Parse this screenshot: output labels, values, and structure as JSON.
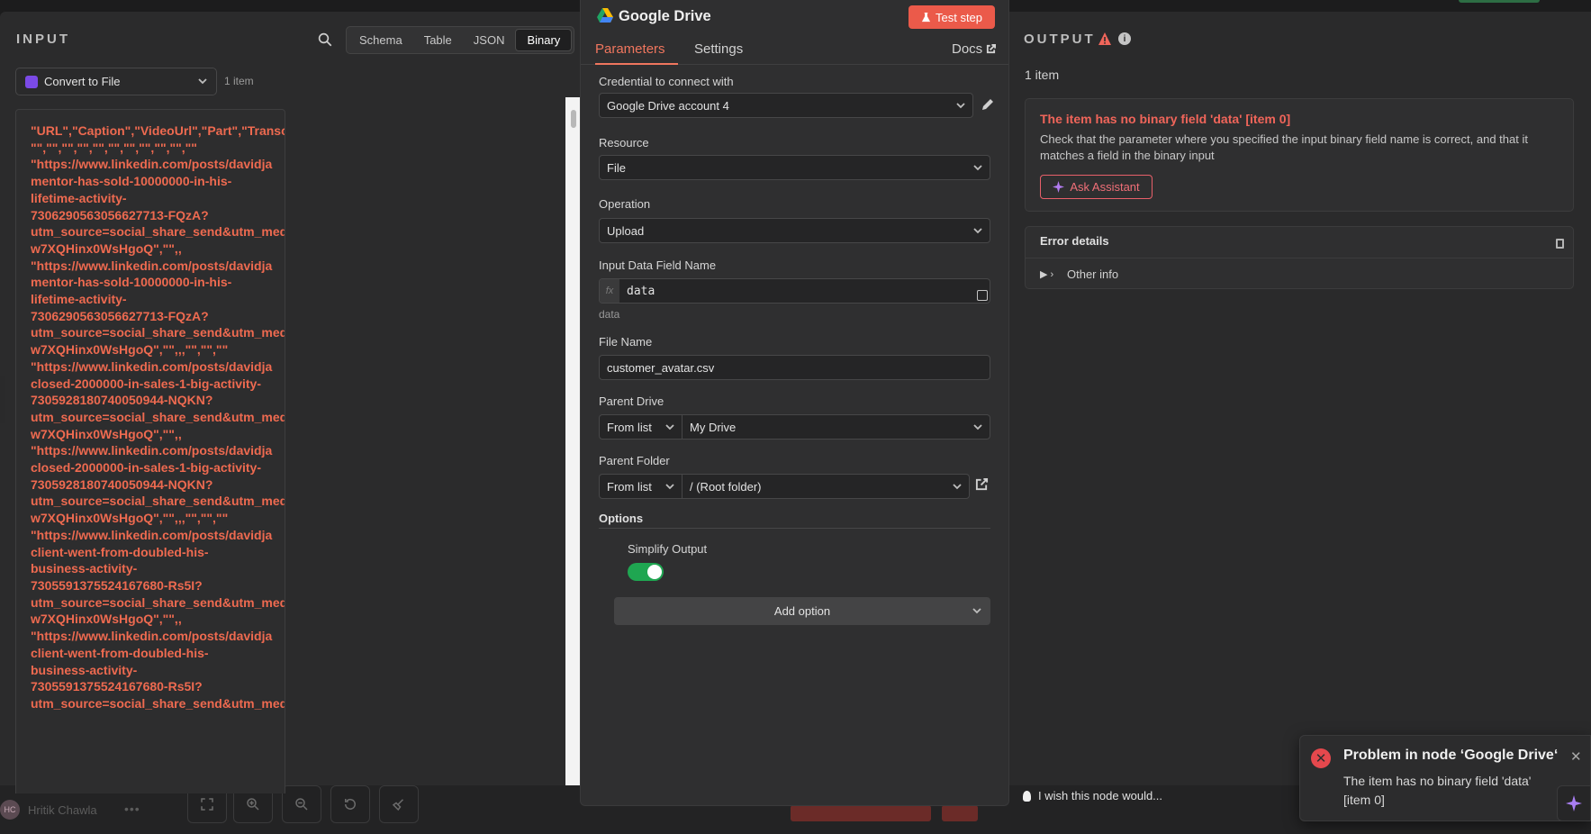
{
  "input_panel": {
    "title": "INPUT",
    "view_tabs": [
      "Schema",
      "Table",
      "JSON",
      "Binary"
    ],
    "active_view_tab": "Binary",
    "node_select_value": "Convert to File",
    "item_count": "1 item",
    "csv_lines": [
      "\"URL\",\"Caption\",\"VideoUrl\",\"Part\",\"Transc",
      "\"\",\"\",\"\",\"\",\"\",\"\",\"\",\"\",\"\",\"\",\"\"",
      "\"https://www.linkedin.com/posts/davidja",
      "mentor-has-sold-10000000-in-his-",
      "lifetime-activity-",
      "7306290563056627713-FQzA?",
      "utm_source=social_share_send&utm_med",
      "w7XQHinx0WsHgoQ\",\"\",,",
      "\"https://www.linkedin.com/posts/davidja",
      "mentor-has-sold-10000000-in-his-",
      "lifetime-activity-",
      "7306290563056627713-FQzA?",
      "utm_source=social_share_send&utm_med",
      "w7XQHinx0WsHgoQ\",\"\",,,\"\",\"\",\"\"",
      "\"https://www.linkedin.com/posts/davidja",
      "closed-2000000-in-sales-1-big-activity-",
      "7305928180740050944-NQKN?",
      "utm_source=social_share_send&utm_med",
      "w7XQHinx0WsHgoQ\",\"\",,",
      "\"https://www.linkedin.com/posts/davidja",
      "closed-2000000-in-sales-1-big-activity-",
      "7305928180740050944-NQKN?",
      "utm_source=social_share_send&utm_med",
      "w7XQHinx0WsHgoQ\",\"\",,,\"\",\"\",\"\"",
      "\"https://www.linkedin.com/posts/davidja",
      "client-went-from-doubled-his-",
      "business-activity-",
      "7305591375524167680-Rs5I?",
      "utm_source=social_share_send&utm_med",
      "w7XQHinx0WsHgoQ\",\"\",,",
      "\"https://www.linkedin.com/posts/davidja",
      "client-went-from-doubled-his-",
      "business-activity-",
      "7305591375524167680-Rs5I?",
      "utm_source=social_share_send&utm_med"
    ]
  },
  "node_panel": {
    "title": "Google Drive",
    "test_step_label": "Test step",
    "tabs": {
      "parameters": "Parameters",
      "settings": "Settings",
      "docs": "Docs"
    },
    "credential": {
      "label": "Credential to connect with",
      "value": "Google Drive account 4"
    },
    "resource": {
      "label": "Resource",
      "value": "File"
    },
    "operation": {
      "label": "Operation",
      "value": "Upload"
    },
    "input_field": {
      "label": "Input Data Field Name",
      "fx": "fx",
      "value": "data",
      "hint": "data"
    },
    "file_name": {
      "label": "File Name",
      "value": "customer_avatar.csv"
    },
    "parent_drive": {
      "label": "Parent Drive",
      "mode": "From list",
      "value": "My Drive"
    },
    "parent_folder": {
      "label": "Parent Folder",
      "mode": "From list",
      "value": "/ (Root folder)"
    },
    "options": {
      "label": "Options",
      "simplify_output_label": "Simplify Output",
      "simplify_output_enabled": true,
      "add_option_label": "Add option"
    }
  },
  "output_panel": {
    "title": "OUTPUT",
    "item_count": "1 item",
    "error": {
      "title": "The item has no binary field 'data' [item 0]",
      "description": "Check that the parameter where you specified the input binary field name is correct, and that it matches a field in the binary input",
      "ask_assistant_label": "Ask Assistant"
    },
    "details": {
      "title": "Error details",
      "other_info_toggle": "▶ ›",
      "other_info_label": "Other info"
    }
  },
  "feedback": {
    "wish_label": "I wish this node would..."
  },
  "toast": {
    "title": "Problem in node ‘Google Drive‘",
    "message": "The item has no binary field 'data' [item 0]",
    "close_glyph": "✕",
    "error_glyph": "✕"
  },
  "footer": {
    "user_initials": "HC",
    "user_name": "Hritik Chawla",
    "menu_dots": "•••"
  },
  "colors": {
    "accent": "#f0765e",
    "error": "#f0655a",
    "success": "#1fa651",
    "test_step": "#eb5a4a",
    "assistant": "#a87ef2"
  }
}
